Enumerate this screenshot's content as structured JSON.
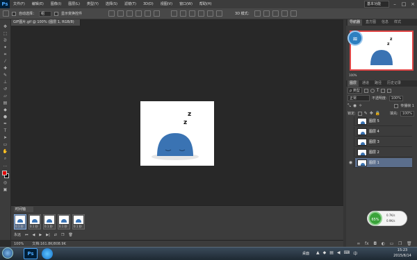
{
  "app": {
    "logo": "Ps",
    "menus": [
      "文件(F)",
      "编辑(E)",
      "图像(I)",
      "图层(L)",
      "类型(Y)",
      "选择(S)",
      "滤镜(T)",
      "3D(D)",
      "视图(V)",
      "窗口(W)",
      "帮助(H)"
    ],
    "workspace": "基本功能"
  },
  "options": {
    "auto_select_label": "自动选择：",
    "auto_select_value": "组",
    "show_transform_label": "显示变换控件",
    "mode_3d_label": "3D 模式："
  },
  "document": {
    "tab_title": "GIF图片.gif @ 100% (图层 1, RGB/8)"
  },
  "canvas": {
    "zzz_big": "z",
    "zzz_small": "z"
  },
  "timeline": {
    "tab_label": "时间轴",
    "frames": [
      {
        "label": "0.1 秒"
      },
      {
        "label": "0.1 秒"
      },
      {
        "label": "0.1 秒"
      },
      {
        "label": "0.1 秒"
      },
      {
        "label": "0.1 秒"
      }
    ],
    "loop_label": "永远"
  },
  "status": {
    "zoom": "100%",
    "doc_info": "文档:161.8K/808.9K"
  },
  "panels": {
    "top_tabs": [
      "导航器",
      "直方图",
      "信息",
      "样式"
    ],
    "layer_tabs": [
      "图层",
      "通道",
      "路径",
      "历史记录"
    ],
    "kind_label": "ρ 类型",
    "blend_mode": "正常",
    "opacity_label": "不透明度:",
    "opacity_value": "100%",
    "lock_label": "锁定:",
    "fill_label": "填充:",
    "fill_value": "100%",
    "propagate_label": "传播帧 1",
    "zoom_value": "100%"
  },
  "layers": [
    {
      "name": "图层 5",
      "selected": false,
      "visible": false
    },
    {
      "name": "图层 4",
      "selected": false,
      "visible": false
    },
    {
      "name": "图层 3",
      "selected": false,
      "visible": false
    },
    {
      "name": "图层 2",
      "selected": false,
      "visible": false
    },
    {
      "name": "图层 1",
      "selected": true,
      "visible": true
    }
  ],
  "net": {
    "percent": "65%",
    "upload": "0.7K/s",
    "download": "0.9K/s"
  },
  "taskbar": {
    "time": "15:23",
    "date": "2015/6/14",
    "desktop_label": "桌面"
  },
  "colors": {
    "accent": "#5b6e8c",
    "foreground_swatch": "#e00000",
    "background_swatch": "#000000",
    "blob": "#3a73b3"
  }
}
